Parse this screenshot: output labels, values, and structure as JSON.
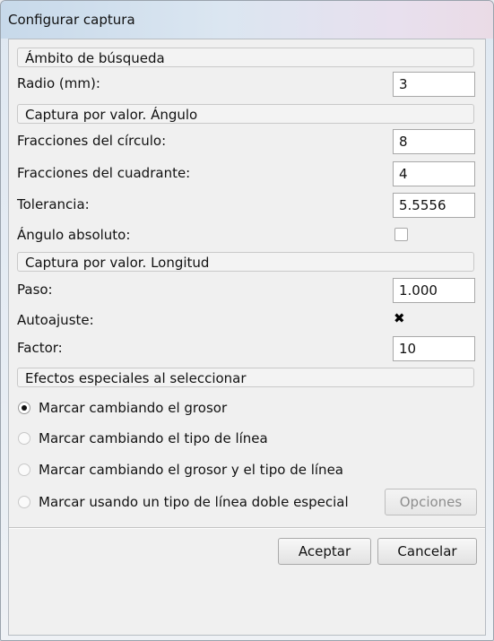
{
  "window": {
    "title": "Configurar captura"
  },
  "sections": {
    "search_scope": "Ámbito de búsqueda",
    "angle_capture": "Captura por valor. Ángulo",
    "length_capture": "Captura por valor. Longitud",
    "special_effects": "Efectos especiales al seleccionar"
  },
  "fields": {
    "radius": {
      "label": "Radio (mm):",
      "value": "3"
    },
    "circle_fractions": {
      "label": "Fracciones del círculo:",
      "value": "8"
    },
    "quadrant_fractions": {
      "label": "Fracciones del cuadrante:",
      "value": "4"
    },
    "tolerance": {
      "label": "Tolerancia:",
      "value": "5.5556"
    },
    "absolute_angle": {
      "label": "Ángulo absoluto:",
      "checked": false
    },
    "step": {
      "label": "Paso:",
      "value": "1.000"
    },
    "autoadjust": {
      "label": "Autoajuste:",
      "checked": true,
      "mark": "✖"
    },
    "factor": {
      "label": "Factor:",
      "value": "10"
    }
  },
  "effects": [
    {
      "label": "Marcar cambiando el grosor",
      "selected": true
    },
    {
      "label": "Marcar cambiando el tipo de línea",
      "selected": false
    },
    {
      "label": "Marcar cambiando el grosor y el tipo de línea",
      "selected": false
    },
    {
      "label": "Marcar usando un tipo de línea doble especial",
      "selected": false
    }
  ],
  "buttons": {
    "options": "Opciones",
    "accept": "Aceptar",
    "cancel": "Cancelar"
  }
}
